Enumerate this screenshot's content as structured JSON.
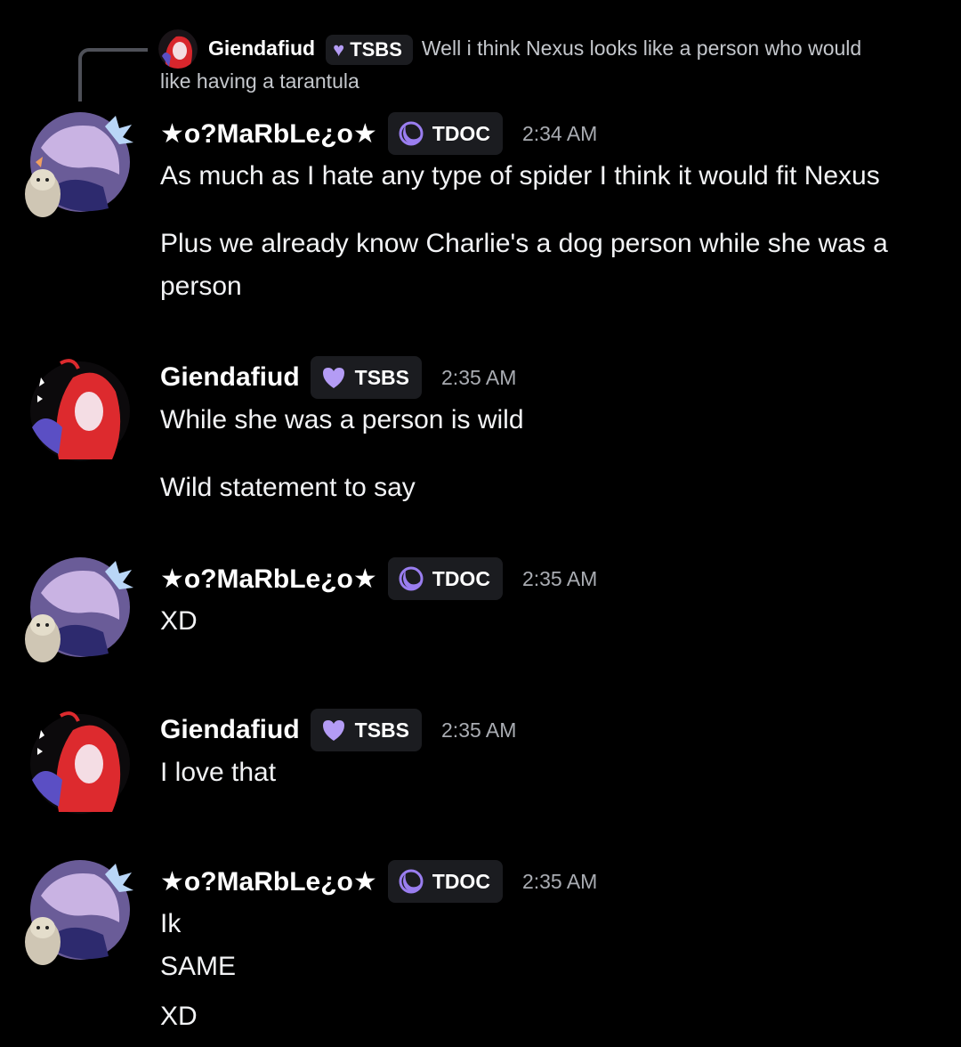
{
  "reply": {
    "username": "Giendafiud",
    "tag": "TSBS",
    "text_first": "Well i think Nexus looks like a person who would",
    "text_second": "like having a tarantula"
  },
  "users": {
    "marble": {
      "name": "★o?MaRbLe¿o★",
      "tag": "TDOC",
      "tag_color": "#9a7ef0"
    },
    "giendafiud": {
      "name": "Giendafiud",
      "tag": "TSBS",
      "tag_color": "#b49cf5"
    }
  },
  "messages": [
    {
      "user": "marble",
      "time": "2:34 AM",
      "lines": [
        "As much as I hate any type of spider I think it would fit Nexus",
        "",
        "Plus we already know Charlie's a dog person while she was a",
        "person"
      ]
    },
    {
      "user": "giendafiud",
      "time": "2:35 AM",
      "lines": [
        "While she was a person is wild",
        "",
        "Wild statement to say"
      ]
    },
    {
      "user": "marble",
      "time": "2:35 AM",
      "lines": [
        "XD"
      ]
    },
    {
      "user": "giendafiud",
      "time": "2:35 AM",
      "lines": [
        "I love that"
      ]
    },
    {
      "user": "marble",
      "time": "2:35 AM",
      "lines": [
        "Ik",
        "SAME",
        "",
        "XD"
      ]
    }
  ]
}
